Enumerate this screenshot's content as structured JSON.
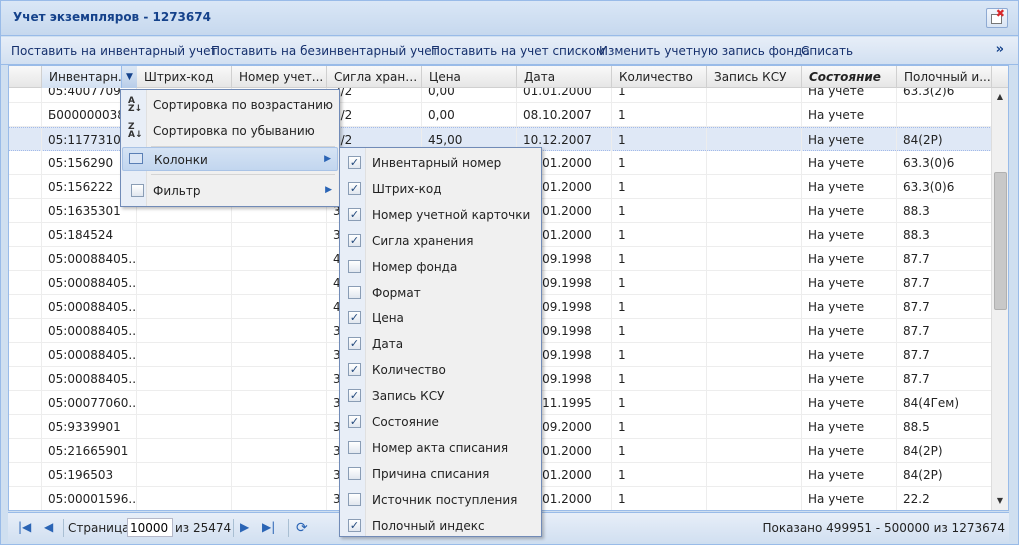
{
  "window": {
    "title": "Учет экземпляров - 1273674"
  },
  "toolbar": {
    "buttons": [
      "Поставить на инвентарный учет",
      "Поставить на безинвентарный учет",
      "Поставить на учет списком",
      "Изменить учетную запись фонда",
      "Списать"
    ],
    "more": "»"
  },
  "grid": {
    "columns": [
      "Инвентарн...",
      "Штрих-код",
      "Номер учет...",
      "Сигла хране...",
      "Цена",
      "Дата",
      "Количество",
      "Запись КСУ",
      "Состояние",
      "Полочный и..."
    ],
    "sort_trigger": "▼",
    "rows": [
      [
        "05:4007709",
        "",
        "",
        "3/2",
        "0,00",
        "01.01.2000",
        "1",
        "",
        "На учете",
        "63.3(2)6"
      ],
      [
        "Б000000038...",
        "",
        "",
        "3/2",
        "0,00",
        "08.10.2007",
        "1",
        "",
        "На учете",
        ""
      ],
      [
        "05:11773101",
        "",
        "",
        "3/2",
        "45,00",
        "10.12.2007",
        "1",
        "",
        "На учете",
        "84(2Р)"
      ],
      [
        "05:156290",
        "",
        "",
        "3",
        "",
        "01.01.2000",
        "1",
        "",
        "На учете",
        "63.3(0)6"
      ],
      [
        "05:156222",
        "",
        "",
        "3",
        "",
        "01.01.2000",
        "1",
        "",
        "На учете",
        "63.3(0)6"
      ],
      [
        "05:1635301",
        "",
        "",
        "3",
        "",
        "01.01.2000",
        "1",
        "",
        "На учете",
        "88.3"
      ],
      [
        "05:184524",
        "",
        "",
        "3",
        "",
        "01.01.2000",
        "1",
        "",
        "На учете",
        "88.3"
      ],
      [
        "05:00088405...",
        "",
        "",
        "4",
        "",
        "09.09.1998",
        "1",
        "",
        "На учете",
        "87.7"
      ],
      [
        "05:00088405...",
        "",
        "",
        "4",
        "",
        "09.09.1998",
        "1",
        "",
        "На учете",
        "87.7"
      ],
      [
        "05:00088405...",
        "",
        "",
        "4",
        "",
        "09.09.1998",
        "1",
        "",
        "На учете",
        "87.7"
      ],
      [
        "05:00088405...",
        "",
        "",
        "3",
        "",
        "09.09.1998",
        "1",
        "",
        "На учете",
        "87.7"
      ],
      [
        "05:00088405...",
        "",
        "",
        "3",
        "",
        "09.09.1998",
        "1",
        "",
        "На учете",
        "87.7"
      ],
      [
        "05:00088405...",
        "",
        "",
        "3",
        "",
        "09.09.1998",
        "1",
        "",
        "На учете",
        "87.7"
      ],
      [
        "05:00077060...",
        "",
        "",
        "3",
        "",
        "11.11.1995",
        "1",
        "",
        "На учете",
        "84(4Гем)"
      ],
      [
        "05:9339901",
        "",
        "",
        "3",
        "",
        "09.09.2000",
        "1",
        "",
        "На учете",
        "88.5"
      ],
      [
        "05:21665901",
        "",
        "",
        "3",
        "",
        "01.01.2000",
        "1",
        "",
        "На учете",
        "84(2Р)"
      ],
      [
        "05:196503",
        "",
        "",
        "3",
        "",
        "01.01.2000",
        "1",
        "",
        "На учете",
        "84(2Р)"
      ],
      [
        "05:00001596...",
        "",
        "",
        "3",
        "",
        "01.01.2000",
        "1",
        "",
        "На учете",
        "22.2"
      ]
    ],
    "selected_row": 2
  },
  "column_menu": {
    "sort_asc": "Сортировка по возрастанию",
    "sort_desc": "Сортировка по убыванию",
    "columns": "Колонки",
    "filter": "Фильтр",
    "filter_checked": false
  },
  "columns_submenu": [
    {
      "label": "Инвентарный номер",
      "checked": true
    },
    {
      "label": "Штрих-код",
      "checked": true
    },
    {
      "label": "Номер учетной карточки",
      "checked": true
    },
    {
      "label": "Сигла хранения",
      "checked": true
    },
    {
      "label": "Номер фонда",
      "checked": false
    },
    {
      "label": "Формат",
      "checked": false
    },
    {
      "label": "Цена",
      "checked": true
    },
    {
      "label": "Дата",
      "checked": true
    },
    {
      "label": "Количество",
      "checked": true
    },
    {
      "label": "Запись КСУ",
      "checked": true
    },
    {
      "label": "Состояние",
      "checked": true
    },
    {
      "label": "Номер акта списания",
      "checked": false
    },
    {
      "label": "Причина списания",
      "checked": false
    },
    {
      "label": "Источник поступления",
      "checked": false
    },
    {
      "label": "Полочный индекс",
      "checked": true
    }
  ],
  "pager": {
    "page_label": "Страница",
    "page_value": "10000",
    "of_label": "из 25474",
    "info": "Показано 499951 - 500000 из 1273674"
  }
}
